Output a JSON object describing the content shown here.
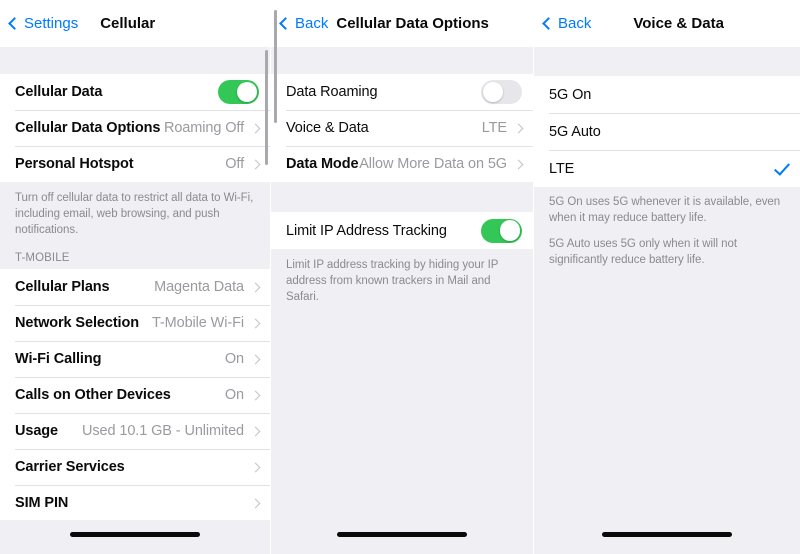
{
  "panels": [
    {
      "id": "cellular",
      "nav": {
        "back_label": "Settings",
        "title": "Cellular",
        "back_icon": "chevron-left-icon"
      },
      "groups": [
        {
          "rows": [
            {
              "label": "Cellular Data",
              "control": "toggle",
              "toggle_state": "on"
            },
            {
              "label": "Cellular Data Options",
              "value": "Roaming Off",
              "control": "chevron"
            },
            {
              "label": "Personal Hotspot",
              "value": "Off",
              "control": "chevron"
            }
          ]
        }
      ],
      "footer": "Turn off cellular data to restrict all data to Wi-Fi, including email, web browsing, and push notifications.",
      "section_header": "T-MOBILE",
      "group2": {
        "rows": [
          {
            "label": "Cellular Plans",
            "value": "Magenta Data",
            "control": "chevron"
          },
          {
            "label": "Network Selection",
            "value": "T-Mobile Wi-Fi",
            "control": "chevron"
          },
          {
            "label": "Wi-Fi Calling",
            "value": "On",
            "control": "chevron"
          },
          {
            "label": "Calls on Other Devices",
            "value": "On",
            "control": "chevron"
          },
          {
            "label": "Usage",
            "value": "Used 10.1 GB - Unlimited",
            "control": "chevron"
          },
          {
            "label": "Carrier Services",
            "value": "",
            "control": "chevron"
          },
          {
            "label": "SIM PIN",
            "value": "",
            "control": "chevron"
          }
        ]
      }
    },
    {
      "id": "cellular-data-options",
      "nav": {
        "back_label": "Back",
        "title": "Cellular Data Options",
        "back_icon": "chevron-left-icon"
      },
      "group1": {
        "rows": [
          {
            "label": "Data Roaming",
            "control": "toggle",
            "toggle_state": "off"
          },
          {
            "label": "Voice & Data",
            "value": "LTE",
            "control": "chevron"
          },
          {
            "label": "Data Mode",
            "value": "Allow More Data on 5G",
            "control": "chevron"
          }
        ]
      },
      "group2": {
        "rows": [
          {
            "label": "Limit IP Address Tracking",
            "control": "toggle",
            "toggle_state": "on"
          }
        ]
      },
      "footer": "Limit IP address tracking by hiding your IP address from known trackers in Mail and Safari."
    },
    {
      "id": "voice-and-data",
      "nav": {
        "back_label": "Back",
        "title": "Voice & Data",
        "back_icon": "chevron-left-icon"
      },
      "options": [
        {
          "label": "5G On",
          "selected": false
        },
        {
          "label": "5G Auto",
          "selected": false
        },
        {
          "label": "LTE",
          "selected": true
        }
      ],
      "footer_1": "5G On uses 5G whenever it is available, even when it may reduce battery life.",
      "footer_2": "5G Auto uses 5G only when it will not significantly reduce battery life."
    }
  ],
  "colors": {
    "accent_blue": "#007aff",
    "toggle_on_green": "#32c756",
    "toggle_off_gray": "#e6e6eb",
    "background_gray": "#f0f0f4",
    "secondary_text": "#8a8a8f"
  }
}
